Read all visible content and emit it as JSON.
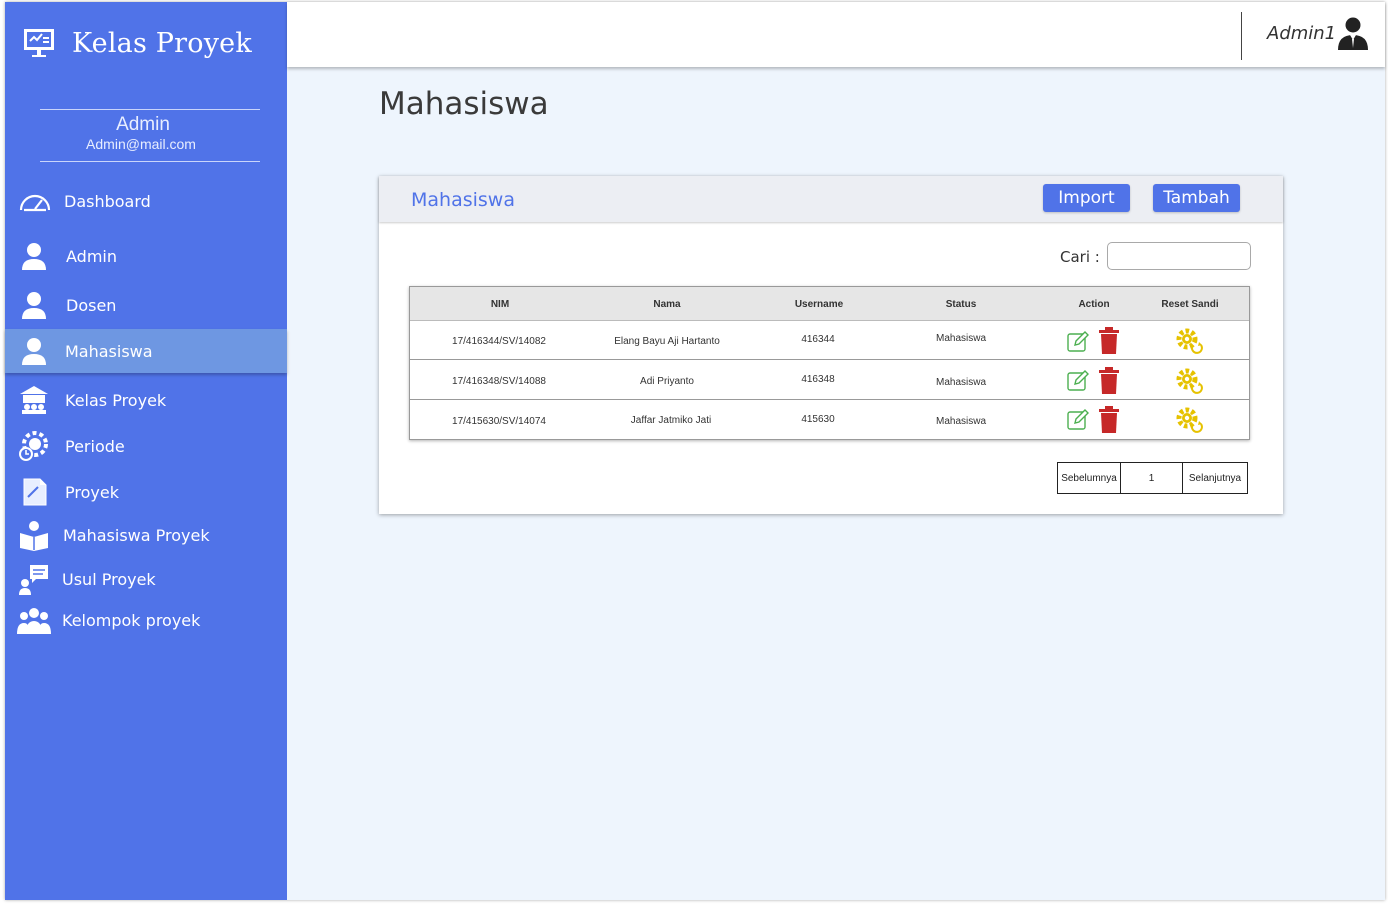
{
  "app": {
    "title": "Kelas Proyek"
  },
  "profile": {
    "name": "Admin",
    "email": "Admin@mail.com"
  },
  "sidebar": {
    "items": [
      {
        "label": "Dashboard",
        "icon": "dashboard-gauge-icon"
      },
      {
        "label": "Admin",
        "icon": "user-icon"
      },
      {
        "label": "Dosen",
        "icon": "user-icon"
      },
      {
        "label": "Mahasiswa",
        "icon": "user-icon",
        "active": true
      },
      {
        "label": "Kelas Proyek",
        "icon": "classroom-icon"
      },
      {
        "label": "Periode",
        "icon": "clock-gear-icon"
      },
      {
        "label": "Proyek",
        "icon": "document-icon"
      },
      {
        "label": "Mahasiswa Proyek",
        "icon": "reader-icon"
      },
      {
        "label": "Usul Proyek",
        "icon": "chat-user-icon"
      },
      {
        "label": "Kelompok proyek",
        "icon": "group-icon"
      }
    ]
  },
  "header": {
    "user": "Admin1"
  },
  "page": {
    "title": "Mahasiswa"
  },
  "card": {
    "title": "Mahasiswa",
    "import_label": "Import",
    "add_label": "Tambah",
    "search_label": "Cari :",
    "search_value": ""
  },
  "table": {
    "columns": [
      "NIM",
      "Nama",
      "Username",
      "Status",
      "Action",
      "Reset Sandi"
    ],
    "rows": [
      {
        "nim": "17/416344/SV/14082",
        "nama": "Elang Bayu Aji Hartanto",
        "username": "416344",
        "status": "Mahasiswa"
      },
      {
        "nim": "17/416348/SV/14088",
        "nama": "Adi Priyanto",
        "username": "416348",
        "status": "Mahasiswa"
      },
      {
        "nim": "17/415630/SV/14074",
        "nama": "Jaffar Jatmiko Jati",
        "username": "415630",
        "status": "Mahasiswa"
      }
    ]
  },
  "pagination": {
    "prev": "Sebelumnya",
    "current": "1",
    "next": "Selanjutnya"
  },
  "colors": {
    "primary": "#5073e8",
    "sidebar_active": "#6e97e2",
    "edit_icon": "#4caf50",
    "delete_icon": "#c62828",
    "reset_icon": "#e6c200",
    "background": "#eef5fd"
  }
}
